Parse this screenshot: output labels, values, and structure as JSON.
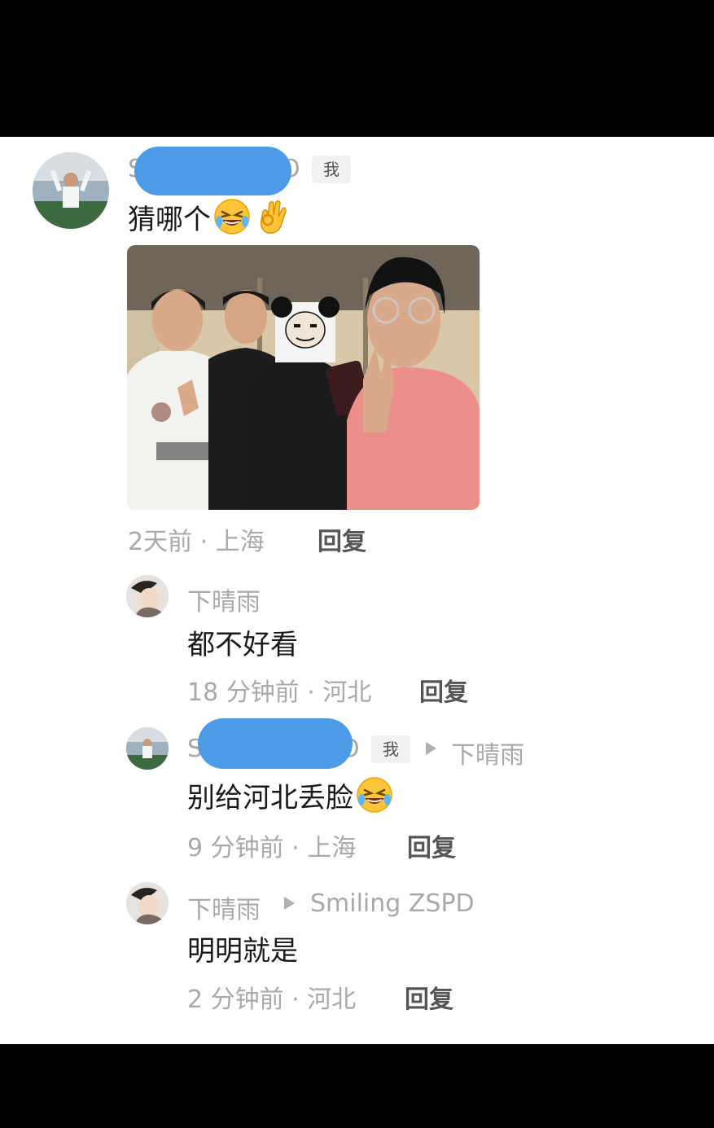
{
  "colors": {
    "redaction": "#4d9be6",
    "meta_text": "#a9a9a9",
    "reply_text": "#555555"
  },
  "main_comment": {
    "name_prefix": "S",
    "name_suffix": "O",
    "me_tag": "我",
    "text": "猜哪个",
    "emojis": [
      "rofl-emoji",
      "ok-hand-emoji"
    ],
    "has_photo": true,
    "time_location": "2天前 · 上海",
    "reply_label": "回复"
  },
  "replies": [
    {
      "author": "下晴雨",
      "text": "都不好看",
      "time_location": "18 分钟前 · 河北",
      "reply_label": "回复"
    },
    {
      "author_prefix": "S",
      "author_suffix": "O",
      "me_tag": "我",
      "reply_to": "下晴雨",
      "text": "别给河北丢脸",
      "emojis": [
        "rofl-emoji"
      ],
      "time_location": "9 分钟前 · 上海",
      "reply_label": "回复"
    },
    {
      "author": "下晴雨",
      "reply_to": "Smiling ZSPD",
      "text": "明明就是",
      "time_location": "2 分钟前 · 河北",
      "reply_label": "回复"
    }
  ]
}
